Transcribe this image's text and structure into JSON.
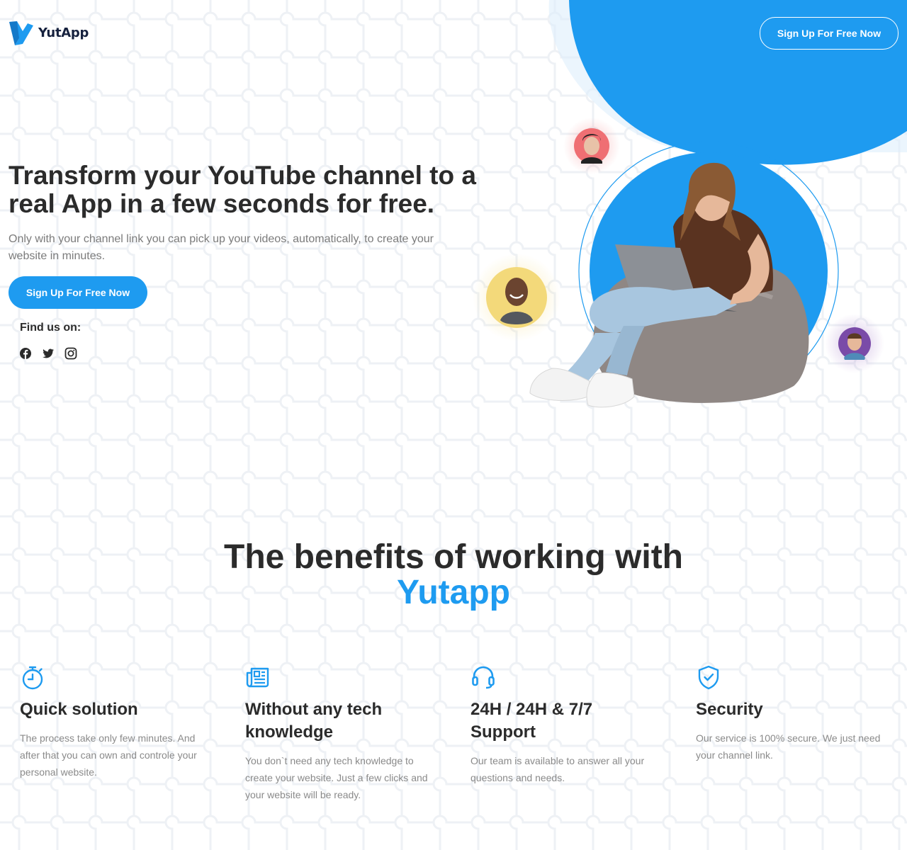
{
  "brand": {
    "name": "YutApp",
    "accent": "#1e9bf0",
    "dark": "#2b2b2b"
  },
  "header": {
    "cta_label": "Sign Up For Free Now"
  },
  "hero": {
    "title": "Transform your YouTube channel to a real App in a few seconds for free.",
    "subtitle": "Only with your channel link you can pick up your videos, automatically, to create your website in minutes.",
    "cta_label": "Sign Up For Free Now",
    "find_us_label": "Find us on:",
    "social": [
      {
        "icon": "facebook-icon"
      },
      {
        "icon": "twitter-icon"
      },
      {
        "icon": "instagram-icon"
      }
    ]
  },
  "benefits": {
    "title_line1": "The benefits of working with",
    "title_accent": "Yutapp",
    "items": [
      {
        "icon": "stopwatch-icon",
        "title": "Quick solution",
        "text": "The process take only few minutes. And after that you can own and controle your personal website."
      },
      {
        "icon": "newspaper-icon",
        "title": "Without any tech knowledge",
        "text": "You don`t need any tech knowledge to create your website. Just a few clicks and your website will be ready."
      },
      {
        "icon": "headset-icon",
        "title": "24H / 24H & 7/7 Support",
        "text": "Our team is available to answer all your questions and needs."
      },
      {
        "icon": "shield-check-icon",
        "title": "Security",
        "text": "Our service is 100% secure. We just need your channel link."
      }
    ]
  }
}
